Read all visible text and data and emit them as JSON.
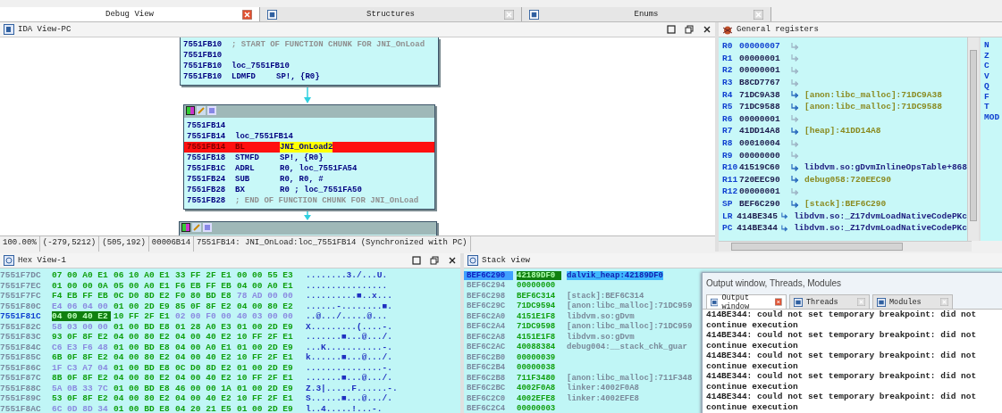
{
  "tabs": [
    {
      "label": "Debug View",
      "selected": true
    },
    {
      "label": "Structures",
      "selected": false
    },
    {
      "label": "Enums",
      "selected": false
    }
  ],
  "ida_view": {
    "title": "IDA View-PC",
    "graph": {
      "blocks": [
        {
          "header": false,
          "lines": [
            {
              "addr": "7551FB10",
              "kind": "comment",
              "text": "; START OF FUNCTION CHUNK FOR JNI_OnLoad",
              "current": false
            },
            {
              "addr": "7551FB10",
              "kind": "blank",
              "current": false
            },
            {
              "addr": "7551FB10",
              "kind": "label",
              "text": "loc_7551FB10",
              "current": false
            },
            {
              "addr": "7551FB10",
              "kind": "insn",
              "mnem": "LDMFD",
              "ops": "SP!, {R0}",
              "current": false
            }
          ]
        },
        {
          "header": true,
          "lines": [
            {
              "addr": "7551FB14",
              "kind": "blank",
              "current": false
            },
            {
              "addr": "7551FB14",
              "kind": "label",
              "text": "loc_7551FB14",
              "current": false
            },
            {
              "addr": "7551FB14",
              "kind": "insn",
              "mnem": "BL",
              "ops": "JNI_OnLoad2",
              "current": true
            },
            {
              "addr": "7551FB18",
              "kind": "insn",
              "mnem": "STMFD",
              "ops": "SP!, {R0}",
              "current": false
            },
            {
              "addr": "7551FB1C",
              "kind": "insn",
              "mnem": "ADRL",
              "ops": "R0, loc_7551FA54",
              "current": false
            },
            {
              "addr": "7551FB24",
              "kind": "insn",
              "mnem": "SUB",
              "ops": "R0, R0, #",
              "current": false
            },
            {
              "addr": "7551FB28",
              "kind": "insn",
              "mnem": "BX",
              "ops": "R0 ; loc_7551FA50",
              "current": false
            },
            {
              "addr": "7551FB28",
              "kind": "comment",
              "text": "; END OF FUNCTION CHUNK FOR JNI_OnLoad",
              "current": false
            }
          ]
        },
        {
          "header": true
        }
      ]
    },
    "status": [
      "100.00%",
      "(-279,5212)",
      "(505,192)",
      "00006B14",
      "7551FB14: JNI_OnLoad:loc_7551FB14 (Synchronized with PC)"
    ]
  },
  "registers": {
    "title": "General registers",
    "rows": [
      {
        "name": "R0",
        "value": "00000007",
        "changed": true,
        "kind": "value"
      },
      {
        "name": "R1",
        "value": "00000001",
        "changed": false,
        "kind": "value"
      },
      {
        "name": "R2",
        "value": "00000001",
        "changed": false,
        "kind": "value"
      },
      {
        "name": "R3",
        "value": "B8CD7767",
        "changed": false,
        "kind": "value"
      },
      {
        "name": "R4",
        "value": "71DC9A38",
        "changed": false,
        "kind": "region",
        "comment": "[anon:libc_malloc]:71DC9A38"
      },
      {
        "name": "R5",
        "value": "71DC9588",
        "changed": false,
        "kind": "region",
        "comment": "[anon:libc_malloc]:71DC9588"
      },
      {
        "name": "R6",
        "value": "00000001",
        "changed": false,
        "kind": "value"
      },
      {
        "name": "R7",
        "value": "41DD14A8",
        "changed": false,
        "kind": "region",
        "comment": "[heap]:41DD14A8"
      },
      {
        "name": "R8",
        "value": "00010004",
        "changed": false,
        "kind": "value"
      },
      {
        "name": "R9",
        "value": "00000000",
        "changed": false,
        "kind": "value"
      },
      {
        "name": "R10",
        "value": "41519C60",
        "changed": false,
        "kind": "symbol",
        "comment": "libdvm.so:gDvmInlineOpsTable+868"
      },
      {
        "name": "R11",
        "value": "720EEC90",
        "changed": false,
        "kind": "region",
        "comment": "debug058:720EEC90"
      },
      {
        "name": "R12",
        "value": "00000001",
        "changed": false,
        "kind": "value"
      },
      {
        "name": "SP",
        "value": "BEF6C290",
        "changed": false,
        "kind": "region",
        "comment": "[stack]:BEF6C290"
      },
      {
        "name": "LR",
        "value": "414BE345",
        "changed": false,
        "kind": "symbol",
        "comment": "libdvm.so:_Z17dvmLoadNativeCodePKc"
      },
      {
        "name": "PC",
        "value": "414BE344",
        "changed": false,
        "kind": "symbol",
        "comment": "libdvm.so:_Z17dvmLoadNativeCodePKc"
      }
    ],
    "flags": [
      "N",
      "Z",
      "C",
      "V",
      "Q",
      "F",
      "T",
      "MOD"
    ]
  },
  "hex_view": {
    "title": "Hex View-1",
    "rows": [
      {
        "addr": "7551F7DC",
        "current": false,
        "groups": [
          {
            "text": "07 00 A0 E1",
            "dim": false,
            "selected": false
          },
          {
            "text": "06 10 A0 E1",
            "dim": false,
            "selected": false
          },
          {
            "text": "33 FF 2F E1",
            "dim": false,
            "selected": false
          },
          {
            "text": "00 00 55 E3",
            "dim": false,
            "selected": false
          }
        ],
        "ascii": "........3./...U."
      },
      {
        "addr": "7551F7EC",
        "current": false,
        "groups": [
          {
            "text": "01 00 00 0A",
            "dim": false,
            "selected": false
          },
          {
            "text": "05 00 A0 E1",
            "dim": false,
            "selected": false
          },
          {
            "text": "F6 EB FF EB",
            "dim": false,
            "selected": false
          },
          {
            "text": "04 00 A0 E1",
            "dim": false,
            "selected": false
          }
        ],
        "ascii": "................"
      },
      {
        "addr": "7551F7FC",
        "current": false,
        "groups": [
          {
            "text": "F4 EB FF EB",
            "dim": false,
            "selected": false
          },
          {
            "text": "0C D0 8D E2",
            "dim": false,
            "selected": false
          },
          {
            "text": "F0 80 BD E8",
            "dim": false,
            "selected": false
          },
          {
            "text": "78 AD 00 00",
            "dim": true,
            "selected": false
          }
        ],
        "ascii": "..........■..x..."
      },
      {
        "addr": "7551F80C",
        "current": false,
        "groups": [
          {
            "text": "E4 06 04 00",
            "dim": true,
            "selected": false
          },
          {
            "text": "01 00 2D E9",
            "dim": false,
            "selected": false
          },
          {
            "text": "85 0F 8F E2",
            "dim": false,
            "selected": false
          },
          {
            "text": "04 00 80 E2",
            "dim": false,
            "selected": false
          }
        ],
        "ascii": "......-........■."
      },
      {
        "addr": "7551F81C",
        "current": true,
        "groups": [
          {
            "text": "04 00 40 E2",
            "dim": false,
            "selected": true
          },
          {
            "text": "10 FF 2F E1",
            "dim": false,
            "selected": false
          },
          {
            "text": "02 00 F0 00",
            "dim": true,
            "selected": false
          },
          {
            "text": "40 03 00 00",
            "dim": true,
            "selected": false
          }
        ],
        "ascii": "..@.../.....@..."
      },
      {
        "addr": "7551F82C",
        "current": false,
        "groups": [
          {
            "text": "58 03 00 00",
            "dim": true,
            "selected": false
          },
          {
            "text": "01 00 BD E8",
            "dim": false,
            "selected": false
          },
          {
            "text": "01 28 A0 E3",
            "dim": false,
            "selected": false
          },
          {
            "text": "01 00 2D E9",
            "dim": false,
            "selected": false
          }
        ],
        "ascii": "X.........(....-."
      },
      {
        "addr": "7551F83C",
        "current": false,
        "groups": [
          {
            "text": "93 0F 8F E2",
            "dim": false,
            "selected": false
          },
          {
            "text": "04 00 80 E2",
            "dim": false,
            "selected": false
          },
          {
            "text": "04 00 40 E2",
            "dim": false,
            "selected": false
          },
          {
            "text": "10 FF 2F E1",
            "dim": false,
            "selected": false
          }
        ],
        "ascii": ".......■...@.../."
      },
      {
        "addr": "7551F84C",
        "current": false,
        "groups": [
          {
            "text": "C6 E3 F6 48",
            "dim": true,
            "selected": false
          },
          {
            "text": "01 00 BD E8",
            "dim": false,
            "selected": false
          },
          {
            "text": "04 00 A0 E1",
            "dim": false,
            "selected": false
          },
          {
            "text": "01 00 2D E9",
            "dim": false,
            "selected": false
          }
        ],
        "ascii": "...K...........-."
      },
      {
        "addr": "7551F85C",
        "current": false,
        "groups": [
          {
            "text": "6B 0F 8F E2",
            "dim": false,
            "selected": false
          },
          {
            "text": "04 00 80 E2",
            "dim": false,
            "selected": false
          },
          {
            "text": "04 00 40 E2",
            "dim": false,
            "selected": false
          },
          {
            "text": "10 FF 2F E1",
            "dim": false,
            "selected": false
          }
        ],
        "ascii": "k......■...@.../."
      },
      {
        "addr": "7551F86C",
        "current": false,
        "groups": [
          {
            "text": "1F C3 A7 04",
            "dim": true,
            "selected": false
          },
          {
            "text": "01 00 BD E8",
            "dim": false,
            "selected": false
          },
          {
            "text": "0C D0 8D E2",
            "dim": false,
            "selected": false
          },
          {
            "text": "01 00 2D E9",
            "dim": false,
            "selected": false
          }
        ],
        "ascii": "...............-."
      },
      {
        "addr": "7551F87C",
        "current": false,
        "groups": [
          {
            "text": "8B 0F 8F E2",
            "dim": false,
            "selected": false
          },
          {
            "text": "04 00 80 E2",
            "dim": false,
            "selected": false
          },
          {
            "text": "04 00 40 E2",
            "dim": false,
            "selected": false
          },
          {
            "text": "10 FF 2F E1",
            "dim": false,
            "selected": false
          }
        ],
        "ascii": ".......■...@.../."
      },
      {
        "addr": "7551F88C",
        "current": false,
        "groups": [
          {
            "text": "5A 0B 33 7C",
            "dim": true,
            "selected": false
          },
          {
            "text": "01 00 BD E8",
            "dim": false,
            "selected": false
          },
          {
            "text": "46 00 00 1A",
            "dim": false,
            "selected": false
          },
          {
            "text": "01 00 2D E9",
            "dim": false,
            "selected": false
          }
        ],
        "ascii": "Z.3|.....F......-."
      },
      {
        "addr": "7551F89C",
        "current": false,
        "groups": [
          {
            "text": "53 0F 8F E2",
            "dim": false,
            "selected": false
          },
          {
            "text": "04 00 80 E2",
            "dim": false,
            "selected": false
          },
          {
            "text": "04 00 40 E2",
            "dim": false,
            "selected": false
          },
          {
            "text": "10 FF 2F E1",
            "dim": false,
            "selected": false
          }
        ],
        "ascii": "S......■...@.../."
      },
      {
        "addr": "7551F8AC",
        "current": false,
        "groups": [
          {
            "text": "6C 0D 8D 34",
            "dim": true,
            "selected": false
          },
          {
            "text": "01 00 BD E8",
            "dim": false,
            "selected": false
          },
          {
            "text": "04 20 21 E5",
            "dim": false,
            "selected": false
          },
          {
            "text": "01 00 2D E9",
            "dim": false,
            "selected": false
          }
        ],
        "ascii": "l..4.....!...-."
      }
    ]
  },
  "stack_view": {
    "title": "Stack view",
    "rows": [
      {
        "addr": "BEF6C290",
        "value": "42189DF0",
        "comment": "dalvik_heap:42189DF0",
        "selected": true
      },
      {
        "addr": "BEF6C294",
        "value": "00000000",
        "selected": false
      },
      {
        "addr": "BEF6C298",
        "value": "BEF6C314",
        "comment": "[stack]:BEF6C314",
        "selected": false
      },
      {
        "addr": "BEF6C29C",
        "value": "71DC9594",
        "comment": "[anon:libc_malloc]:71DC959",
        "selected": false
      },
      {
        "addr": "BEF6C2A0",
        "value": "4151E1F8",
        "comment": "libdvm.so:**gDvm**",
        "selected": false
      },
      {
        "addr": "BEF6C2A4",
        "value": "71DC9598",
        "comment": "[anon:libc_malloc]:71DC959",
        "selected": false
      },
      {
        "addr": "BEF6C2A8",
        "value": "4151E1F8",
        "comment": "libdvm.so:**gDvm**",
        "selected": false
      },
      {
        "addr": "BEF6C2AC",
        "value": "40088384",
        "comment": "debug004:**__stack_chk_guar**",
        "selected": false
      },
      {
        "addr": "BEF6C2B0",
        "value": "00000039",
        "selected": false
      },
      {
        "addr": "BEF6C2B4",
        "value": "00000038",
        "selected": false
      },
      {
        "addr": "BEF6C2B8",
        "value": "711F3480",
        "comment": "[anon:libc_malloc]:711F348",
        "selected": false
      },
      {
        "addr": "BEF6C2BC",
        "value": "4002F0A8",
        "comment": "linker:4002F0A8",
        "selected": false
      },
      {
        "addr": "BEF6C2C0",
        "value": "4002EFE8",
        "comment": "linker:4002EFE8",
        "selected": false
      },
      {
        "addr": "BEF6C2C4",
        "value": "00000003",
        "selected": false
      }
    ]
  },
  "output_window": {
    "title": "Output window, Threads, Modules",
    "tabs": [
      {
        "label": "Output window",
        "selected": true
      },
      {
        "label": "Threads",
        "selected": false
      },
      {
        "label": "Modules",
        "selected": false
      }
    ],
    "messages": [
      "414BE344: could not set temporary breakpoint: did not continue execution",
      "414BE344: could not set temporary breakpoint: did not continue execution",
      "414BE344: could not set temporary breakpoint: did not continue execution",
      "414BE344: could not set temporary breakpoint: did not continue execution",
      "414BE344: could not set temporary breakpoint: did not continue execution"
    ]
  }
}
